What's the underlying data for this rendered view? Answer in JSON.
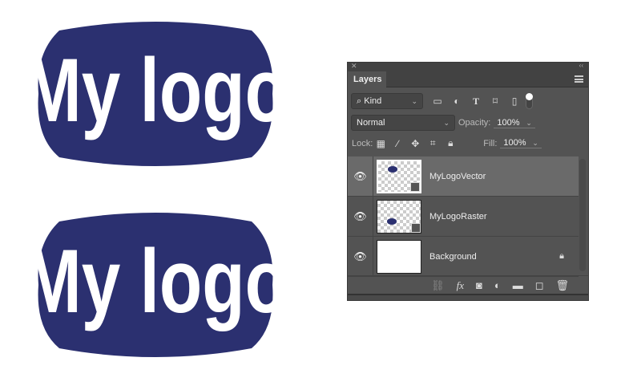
{
  "canvas": {
    "logo_text": "My logo",
    "logo_color": "#2b3070"
  },
  "panel": {
    "title": "Layers",
    "filter": {
      "kind_label": "Kind"
    },
    "blend": {
      "mode": "Normal",
      "opacity_label": "Opacity:",
      "opacity": "100%"
    },
    "lock": {
      "label": "Lock:",
      "fill_label": "Fill:",
      "fill": "100%"
    },
    "layers": [
      {
        "name": "MyLogoVector"
      },
      {
        "name": "MyLogoRaster"
      },
      {
        "name": "Background"
      }
    ]
  }
}
